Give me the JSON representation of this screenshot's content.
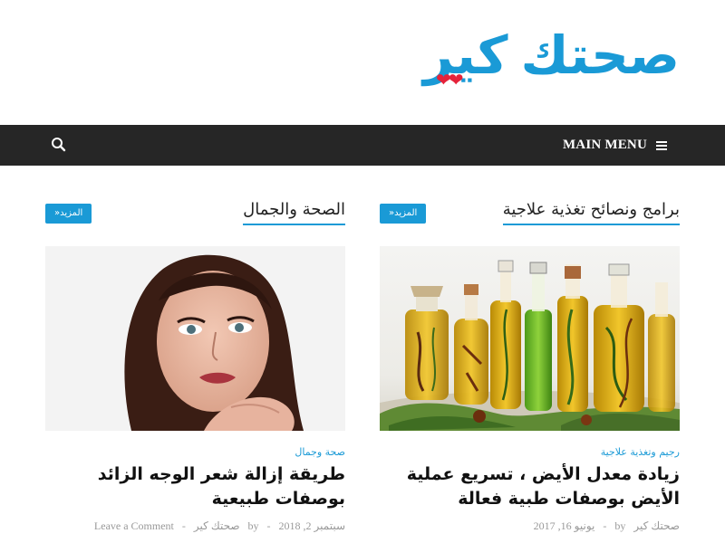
{
  "site": {
    "logo_word1": "صحتك",
    "logo_word2": "كير",
    "logo_hearts": "❤❤"
  },
  "nav": {
    "menu_label": "MAIN MENU",
    "search_icon": "search-icon",
    "menu_icon": "hamburger-icon",
    "background": "#262626"
  },
  "colors": {
    "accent": "#1a9ad6",
    "heart": "#e5223a"
  },
  "sections": [
    {
      "title": "برامج ونصائح تغذية علاجية",
      "more_label": "المزيد«",
      "post": {
        "category": "رجيم وتغذية علاجية",
        "title": "زيادة معدل الأيض ، تسريع عملية الأيض بوصفات طبية فعالة",
        "date": "يونيو 16, 2017",
        "by": "by",
        "author": "صحتك كير",
        "comments": ""
      }
    },
    {
      "title": "الصحة والجمال",
      "more_label": "المزيد«",
      "post": {
        "category": "صحة وجمال",
        "title": "طريقة إزالة شعر الوجه الزائد بوصفات طبيعية",
        "date": "سبتمبر 2, 2018",
        "by": "by",
        "author": "صحتك كير",
        "comments": "Leave a Comment"
      }
    }
  ]
}
